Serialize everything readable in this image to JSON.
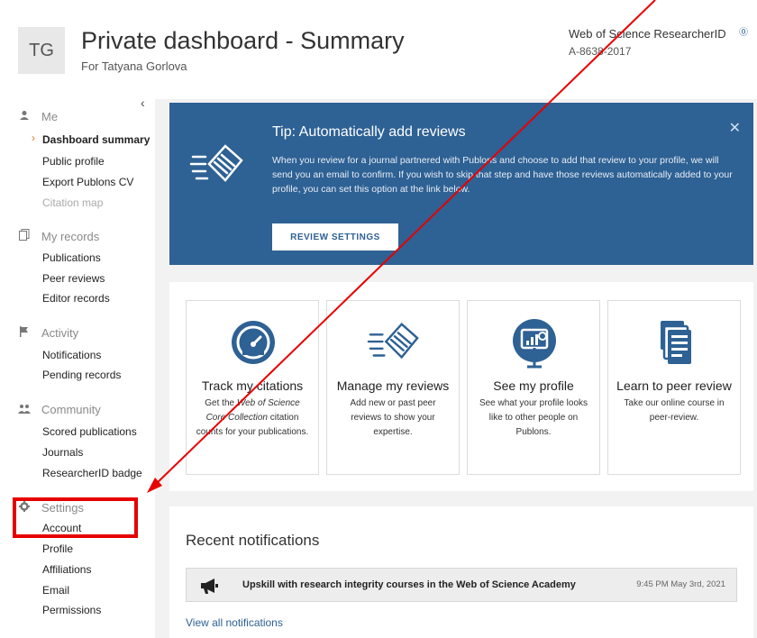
{
  "header": {
    "avatar_initials": "TG",
    "title": "Private dashboard - Summary",
    "subtitle": "For Tatyana Gorlova",
    "rid_label": "Web of Science ResearcherID",
    "rid_help": "⓪",
    "rid_value": "A-8638-2017"
  },
  "sidebar": {
    "collapse_glyph": "‹",
    "groups": [
      {
        "label": "Me",
        "icon": "person-icon",
        "items": [
          "Dashboard summary",
          "Public profile",
          "Export Publons CV",
          "Citation map"
        ],
        "active_item": "Dashboard summary",
        "muted_item": "Citation map"
      },
      {
        "label": "My records",
        "icon": "records-icon",
        "items": [
          "Publications",
          "Peer reviews",
          "Editor records"
        ]
      },
      {
        "label": "Activity",
        "icon": "flag-icon",
        "items": [
          "Notifications",
          "Pending records"
        ]
      },
      {
        "label": "Community",
        "icon": "people-icon",
        "items": [
          "Scored publications",
          "Journals",
          "ResearcherID badge"
        ]
      },
      {
        "label": "Settings",
        "icon": "gear-icon",
        "items": [
          "Account",
          "Profile",
          "Affiliations",
          "Email",
          "Permissions"
        ]
      }
    ]
  },
  "tip": {
    "title": "Tip:  Automatically add reviews",
    "body": "When you review for a journal partnered with Publons and choose to add that review to your profile, we will send you an email to confirm. If you wish to skip that step and have those reviews automatically added to your profile, you can set this option at the link below.",
    "button": "REVIEW SETTINGS",
    "close": "✕"
  },
  "cards": [
    {
      "title": "Track my citations",
      "desc_pre": "Get the ",
      "desc_em": "Web of Science Core Collection",
      "desc_post": " citation counts for your publications.",
      "icon": "gauge-icon"
    },
    {
      "title": "Manage my reviews",
      "desc": "Add new or past peer reviews to show your expertise.",
      "icon": "document-icon"
    },
    {
      "title": "See my profile",
      "desc": "See what your profile looks like to other people on Publons.",
      "icon": "monitor-chart-icon"
    },
    {
      "title": "Learn to peer review",
      "desc": "Take our online course in peer-review.",
      "icon": "papers-icon"
    }
  ],
  "notifications": {
    "title": "Recent notifications",
    "items": [
      {
        "text": "Upskill with research integrity courses in the Web of Science Academy",
        "time": "9:45 PM May 3rd, 2021",
        "icon": "megaphone-icon"
      }
    ],
    "view_all": "View all notifications"
  },
  "colors": {
    "banner": "#2e6194",
    "accent_orange": "#d97a1d",
    "annotation_red": "#e60000"
  }
}
